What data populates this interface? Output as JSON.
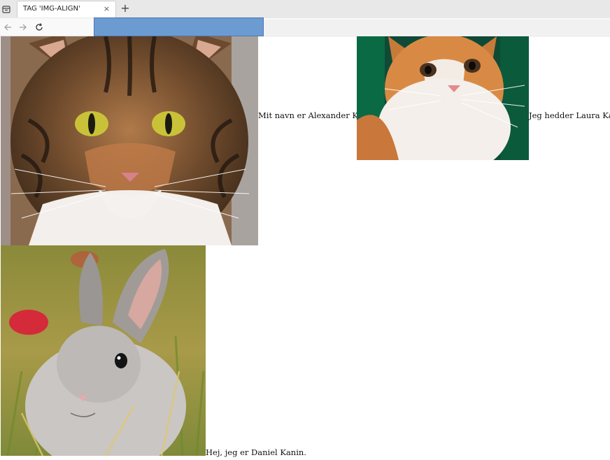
{
  "browser": {
    "tab_title": "TAG 'IMG-ALIGN'",
    "tab_close": "×",
    "new_tab": "+"
  },
  "page": {
    "images": [
      {
        "name": "alexander-cat-image",
        "subject": "tabby cat",
        "caption": "Mit navn er Alexander Kat."
      },
      {
        "name": "laura-cat-image",
        "subject": "orange and white cat",
        "caption": "Jeg hedder Laura Kat."
      },
      {
        "name": "daniel-rabbit-image",
        "subject": "grey rabbit",
        "caption": "Hej, jeg er Daniel Kanin."
      }
    ]
  }
}
